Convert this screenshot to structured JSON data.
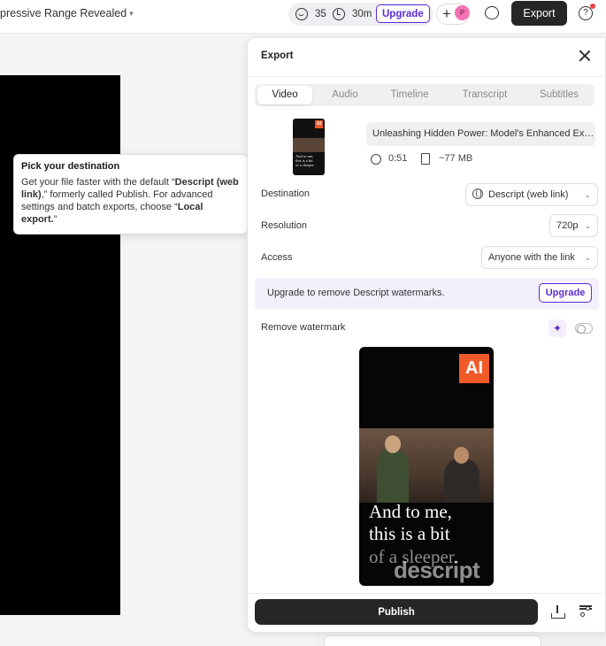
{
  "topbar": {
    "doc_title": "pressive Range Revealed",
    "face_count": "35",
    "time_left": "30m",
    "upgrade_label": "Upgrade",
    "avatar_initial": "P",
    "export_label": "Export",
    "help_glyph": "?"
  },
  "tooltip": {
    "title": "Pick your destination",
    "body_part1": "Get your file faster with the default “",
    "body_bold1": "Descript (web link)",
    "body_part2": ",” formerly called Publish. For advanced settings and batch exports, choose “",
    "body_bold2": "Local export.",
    "body_part3": "”"
  },
  "export_panel": {
    "title": "Export",
    "tabs": [
      {
        "label": "Video",
        "active": true
      },
      {
        "label": "Audio",
        "active": false
      },
      {
        "label": "Timeline",
        "active": false
      },
      {
        "label": "Transcript",
        "active": false
      },
      {
        "label": "Subtitles",
        "active": false
      }
    ],
    "file_name": "Unleashing Hidden Power: Model's Enhanced Exp...",
    "duration": "0:51",
    "size": "~77 MB",
    "destination_label": "Destination",
    "destination_value": "Descript (web link)",
    "resolution_label": "Resolution",
    "resolution_value": "720p",
    "access_label": "Access",
    "access_value": "Anyone with the link",
    "banner_text": "Upgrade to remove Descript watermarks.",
    "banner_button": "Upgrade",
    "remove_watermark_label": "Remove watermark",
    "remove_watermark_on": false,
    "preview": {
      "ai_badge": "AI",
      "caption_lines": [
        "And to me,",
        "this is a bit",
        "of a sleeper."
      ],
      "watermark": "descript"
    },
    "publish_label": "Publish"
  },
  "colors": {
    "accent": "#5b2bd9",
    "dark_button": "#262626",
    "ai_badge": "#f15b2a"
  }
}
